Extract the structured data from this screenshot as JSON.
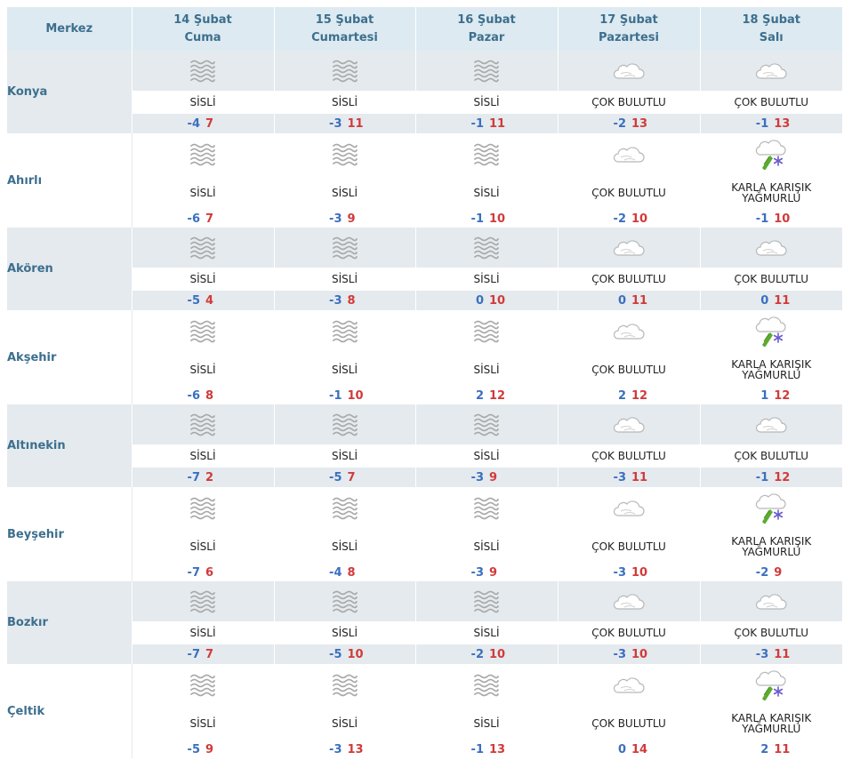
{
  "header": {
    "first_col": "Merkez",
    "days": [
      {
        "date": "14 Şubat",
        "weekday": "Cuma"
      },
      {
        "date": "15 Şubat",
        "weekday": "Cumartesi"
      },
      {
        "date": "16 Şubat",
        "weekday": "Pazar"
      },
      {
        "date": "17 Şubat",
        "weekday": "Pazartesi"
      },
      {
        "date": "18 Şubat",
        "weekday": "Salı"
      }
    ]
  },
  "colors": {
    "header_bg": "#ddeaf1",
    "row_shade": "#e4eaee",
    "city_text": "#3d6f8e",
    "min_temp": "#3b6fc0",
    "max_temp": "#d23a3a"
  },
  "rows": [
    {
      "city": "Konya",
      "days": [
        {
          "icon": "fog-icon",
          "desc": "SİSLİ",
          "min": "-4",
          "max": "7"
        },
        {
          "icon": "fog-icon",
          "desc": "SİSLİ",
          "min": "-3",
          "max": "11"
        },
        {
          "icon": "fog-icon",
          "desc": "SİSLİ",
          "min": "-1",
          "max": "11"
        },
        {
          "icon": "cloud-icon",
          "desc": "ÇOK BULUTLU",
          "min": "-2",
          "max": "13"
        },
        {
          "icon": "cloud-icon",
          "desc": "ÇOK BULUTLU",
          "min": "-1",
          "max": "13"
        }
      ]
    },
    {
      "city": "Ahırlı",
      "days": [
        {
          "icon": "fog-icon",
          "desc": "SİSLİ",
          "min": "-6",
          "max": "7"
        },
        {
          "icon": "fog-icon",
          "desc": "SİSLİ",
          "min": "-3",
          "max": "9"
        },
        {
          "icon": "fog-icon",
          "desc": "SİSLİ",
          "min": "-1",
          "max": "10"
        },
        {
          "icon": "cloud-icon",
          "desc": "ÇOK BULUTLU",
          "min": "-2",
          "max": "10"
        },
        {
          "icon": "sleet-icon",
          "desc": "KARLA KARIŞIK YAĞMURLU",
          "min": "-1",
          "max": "10"
        }
      ]
    },
    {
      "city": "Akören",
      "days": [
        {
          "icon": "fog-icon",
          "desc": "SİSLİ",
          "min": "-5",
          "max": "4"
        },
        {
          "icon": "fog-icon",
          "desc": "SİSLİ",
          "min": "-3",
          "max": "8"
        },
        {
          "icon": "fog-icon",
          "desc": "SİSLİ",
          "min": "0",
          "max": "10"
        },
        {
          "icon": "cloud-icon",
          "desc": "ÇOK BULUTLU",
          "min": "0",
          "max": "11"
        },
        {
          "icon": "cloud-icon",
          "desc": "ÇOK BULUTLU",
          "min": "0",
          "max": "11"
        }
      ]
    },
    {
      "city": "Akşehir",
      "days": [
        {
          "icon": "fog-icon",
          "desc": "SİSLİ",
          "min": "-6",
          "max": "8"
        },
        {
          "icon": "fog-icon",
          "desc": "SİSLİ",
          "min": "-1",
          "max": "10"
        },
        {
          "icon": "fog-icon",
          "desc": "SİSLİ",
          "min": "2",
          "max": "12"
        },
        {
          "icon": "cloud-icon",
          "desc": "ÇOK BULUTLU",
          "min": "2",
          "max": "12"
        },
        {
          "icon": "sleet-icon",
          "desc": "KARLA KARIŞIK YAĞMURLU",
          "min": "1",
          "max": "12"
        }
      ]
    },
    {
      "city": "Altınekin",
      "days": [
        {
          "icon": "fog-icon",
          "desc": "SİSLİ",
          "min": "-7",
          "max": "2"
        },
        {
          "icon": "fog-icon",
          "desc": "SİSLİ",
          "min": "-5",
          "max": "7"
        },
        {
          "icon": "fog-icon",
          "desc": "SİSLİ",
          "min": "-3",
          "max": "9"
        },
        {
          "icon": "cloud-icon",
          "desc": "ÇOK BULUTLU",
          "min": "-3",
          "max": "11"
        },
        {
          "icon": "cloud-icon",
          "desc": "ÇOK BULUTLU",
          "min": "-1",
          "max": "12"
        }
      ]
    },
    {
      "city": "Beyşehir",
      "days": [
        {
          "icon": "fog-icon",
          "desc": "SİSLİ",
          "min": "-7",
          "max": "6"
        },
        {
          "icon": "fog-icon",
          "desc": "SİSLİ",
          "min": "-4",
          "max": "8"
        },
        {
          "icon": "fog-icon",
          "desc": "SİSLİ",
          "min": "-3",
          "max": "9"
        },
        {
          "icon": "cloud-icon",
          "desc": "ÇOK BULUTLU",
          "min": "-3",
          "max": "10"
        },
        {
          "icon": "sleet-icon",
          "desc": "KARLA KARIŞIK YAĞMURLU",
          "min": "-2",
          "max": "9"
        }
      ]
    },
    {
      "city": "Bozkır",
      "days": [
        {
          "icon": "fog-icon",
          "desc": "SİSLİ",
          "min": "-7",
          "max": "7"
        },
        {
          "icon": "fog-icon",
          "desc": "SİSLİ",
          "min": "-5",
          "max": "10"
        },
        {
          "icon": "fog-icon",
          "desc": "SİSLİ",
          "min": "-2",
          "max": "10"
        },
        {
          "icon": "cloud-icon",
          "desc": "ÇOK BULUTLU",
          "min": "-3",
          "max": "10"
        },
        {
          "icon": "cloud-icon",
          "desc": "ÇOK BULUTLU",
          "min": "-3",
          "max": "11"
        }
      ]
    },
    {
      "city": "Çeltik",
      "days": [
        {
          "icon": "fog-icon",
          "desc": "SİSLİ",
          "min": "-5",
          "max": "9"
        },
        {
          "icon": "fog-icon",
          "desc": "SİSLİ",
          "min": "-3",
          "max": "13"
        },
        {
          "icon": "fog-icon",
          "desc": "SİSLİ",
          "min": "-1",
          "max": "13"
        },
        {
          "icon": "cloud-icon",
          "desc": "ÇOK BULUTLU",
          "min": "0",
          "max": "14"
        },
        {
          "icon": "sleet-icon",
          "desc": "KARLA KARIŞIK YAĞMURLU",
          "min": "2",
          "max": "11"
        }
      ]
    }
  ]
}
